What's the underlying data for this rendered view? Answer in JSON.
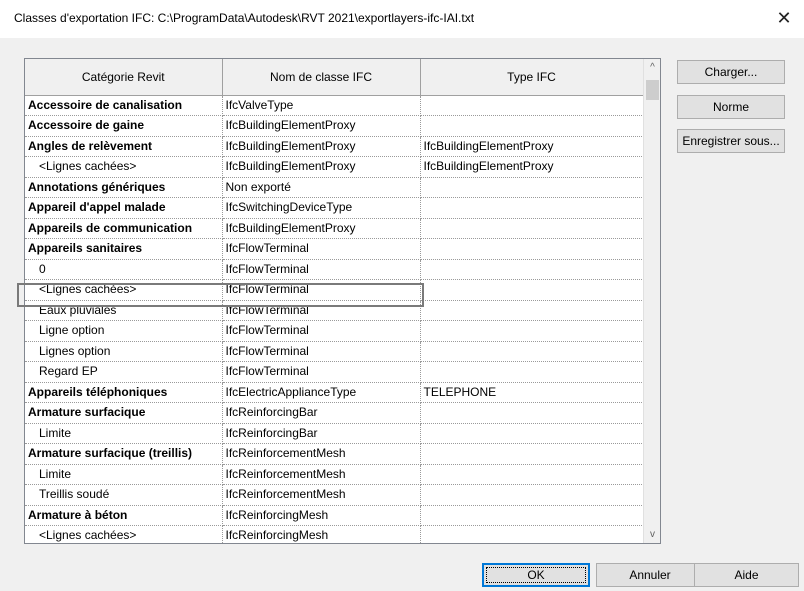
{
  "window": {
    "title": "Classes d'exportation IFC: C:\\ProgramData\\Autodesk\\RVT 2021\\exportlayers-ifc-IAI.txt",
    "close_glyph": "✕"
  },
  "table": {
    "headers": [
      "Catégorie Revit",
      "Nom de classe IFC",
      "Type IFC"
    ],
    "rows": [
      {
        "category": "Accessoire de canalisation",
        "ifc_class": "IfcValveType",
        "ifc_type": "",
        "sub": false
      },
      {
        "category": "Accessoire de gaine",
        "ifc_class": "IfcBuildingElementProxy",
        "ifc_type": "",
        "sub": false
      },
      {
        "category": "Angles de relèvement",
        "ifc_class": "IfcBuildingElementProxy",
        "ifc_type": "IfcBuildingElementProxy",
        "sub": false
      },
      {
        "category": "<Lignes cachées>",
        "ifc_class": "IfcBuildingElementProxy",
        "ifc_type": "IfcBuildingElementProxy",
        "sub": true
      },
      {
        "category": "Annotations génériques",
        "ifc_class": "Non exporté",
        "ifc_type": "",
        "sub": false
      },
      {
        "category": "Appareil d'appel malade",
        "ifc_class": "IfcSwitchingDeviceType",
        "ifc_type": "",
        "sub": false
      },
      {
        "category": "Appareils de communication",
        "ifc_class": "IfcBuildingElementProxy",
        "ifc_type": "",
        "sub": false
      },
      {
        "category": "Appareils sanitaires",
        "ifc_class": "IfcFlowTerminal",
        "ifc_type": "",
        "sub": false
      },
      {
        "category": "0",
        "ifc_class": "IfcFlowTerminal",
        "ifc_type": "",
        "sub": true
      },
      {
        "category": "<Lignes cachées>",
        "ifc_class": "IfcFlowTerminal",
        "ifc_type": "",
        "sub": true
      },
      {
        "category": "Eaux pluviales",
        "ifc_class": "IfcFlowTerminal",
        "ifc_type": "",
        "sub": true
      },
      {
        "category": "Ligne option",
        "ifc_class": "IfcFlowTerminal",
        "ifc_type": "",
        "sub": true
      },
      {
        "category": "Lignes option",
        "ifc_class": "IfcFlowTerminal",
        "ifc_type": "",
        "sub": true
      },
      {
        "category": "Regard EP",
        "ifc_class": "IfcFlowTerminal",
        "ifc_type": "",
        "sub": true
      },
      {
        "category": "Appareils téléphoniques",
        "ifc_class": "IfcElectricApplianceType",
        "ifc_type": "TELEPHONE",
        "sub": false
      },
      {
        "category": "Armature surfacique",
        "ifc_class": "IfcReinforcingBar",
        "ifc_type": "",
        "sub": false
      },
      {
        "category": "Limite",
        "ifc_class": "IfcReinforcingBar",
        "ifc_type": "",
        "sub": true
      },
      {
        "category": "Armature surfacique (treillis)",
        "ifc_class": "IfcReinforcementMesh",
        "ifc_type": "",
        "sub": false
      },
      {
        "category": "Limite",
        "ifc_class": "IfcReinforcementMesh",
        "ifc_type": "",
        "sub": true
      },
      {
        "category": "Treillis soudé",
        "ifc_class": "IfcReinforcementMesh",
        "ifc_type": "",
        "sub": true
      },
      {
        "category": "Armature à béton",
        "ifc_class": "IfcReinforcingMesh",
        "ifc_type": "",
        "sub": false
      },
      {
        "category": "<Lignes cachées>",
        "ifc_class": "IfcReinforcingMesh",
        "ifc_type": "",
        "sub": true
      }
    ]
  },
  "scrollbar": {
    "up_glyph": "^",
    "down_glyph": "v"
  },
  "side_buttons": {
    "load": "Charger...",
    "standard": "Norme",
    "save_as": "Enregistrer sous..."
  },
  "footer_buttons": {
    "ok": "OK",
    "cancel": "Annuler",
    "help": "Aide"
  }
}
